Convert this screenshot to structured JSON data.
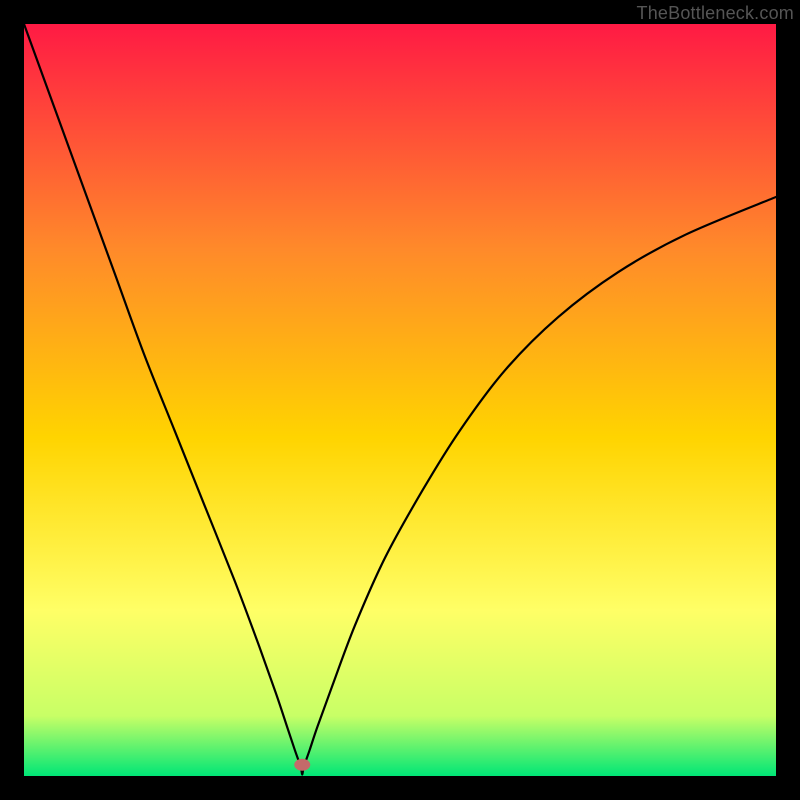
{
  "watermark": "TheBottleneck.com",
  "chart_data": {
    "type": "line",
    "title": "",
    "xlabel": "",
    "ylabel": "",
    "xlim": [
      0,
      100
    ],
    "ylim": [
      0,
      100
    ],
    "grid": false,
    "gradient_colors": {
      "top": "#ff1a44",
      "upper_mid": "#ff8a2a",
      "mid": "#ffd400",
      "lower_mid": "#ffff66",
      "near_bottom": "#c8ff66",
      "bottom": "#00e676"
    },
    "marker": {
      "x_percent": 37,
      "y_percent": 1.5,
      "color": "#c46a6a",
      "rx": 8,
      "ry": 6
    },
    "series": [
      {
        "name": "bottleneck-curve",
        "x_percent": [
          0,
          4,
          8,
          12,
          16,
          20,
          24,
          28,
          31,
          33.5,
          35,
          36,
          36.8,
          37,
          37.2,
          38,
          39,
          41,
          44,
          48,
          53,
          58,
          64,
          71,
          79,
          88,
          100
        ],
        "y_percent": [
          100,
          89,
          78,
          67,
          56,
          46,
          36,
          26,
          18,
          11,
          6.5,
          3.5,
          1.2,
          0.2,
          1.2,
          3.5,
          6.5,
          12,
          20,
          29,
          38,
          46,
          54,
          61,
          67,
          72,
          77
        ]
      }
    ]
  }
}
